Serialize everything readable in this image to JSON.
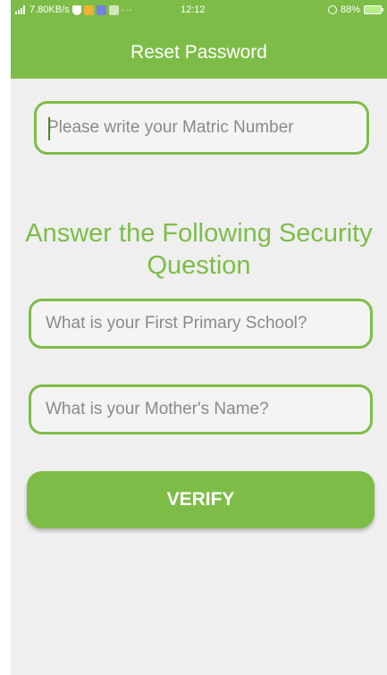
{
  "status_bar": {
    "network_speed": "7.80KB/s",
    "more_indicator": "···",
    "time": "12:12",
    "battery_level": "88%"
  },
  "header": {
    "title": "Reset Password",
    "color": "#7dbd47"
  },
  "form": {
    "matric_placeholder": "Please write your Matric Number",
    "security_heading": "Answer the Following Security Question",
    "school_placeholder": "What is your First Primary School?",
    "mother_placeholder": "What is your Mother's Name?",
    "verify_label": "VERIFY"
  },
  "colors": {
    "accent": "#7dbd47",
    "background": "#efefef",
    "placeholder_text": "#8a8a8a"
  }
}
